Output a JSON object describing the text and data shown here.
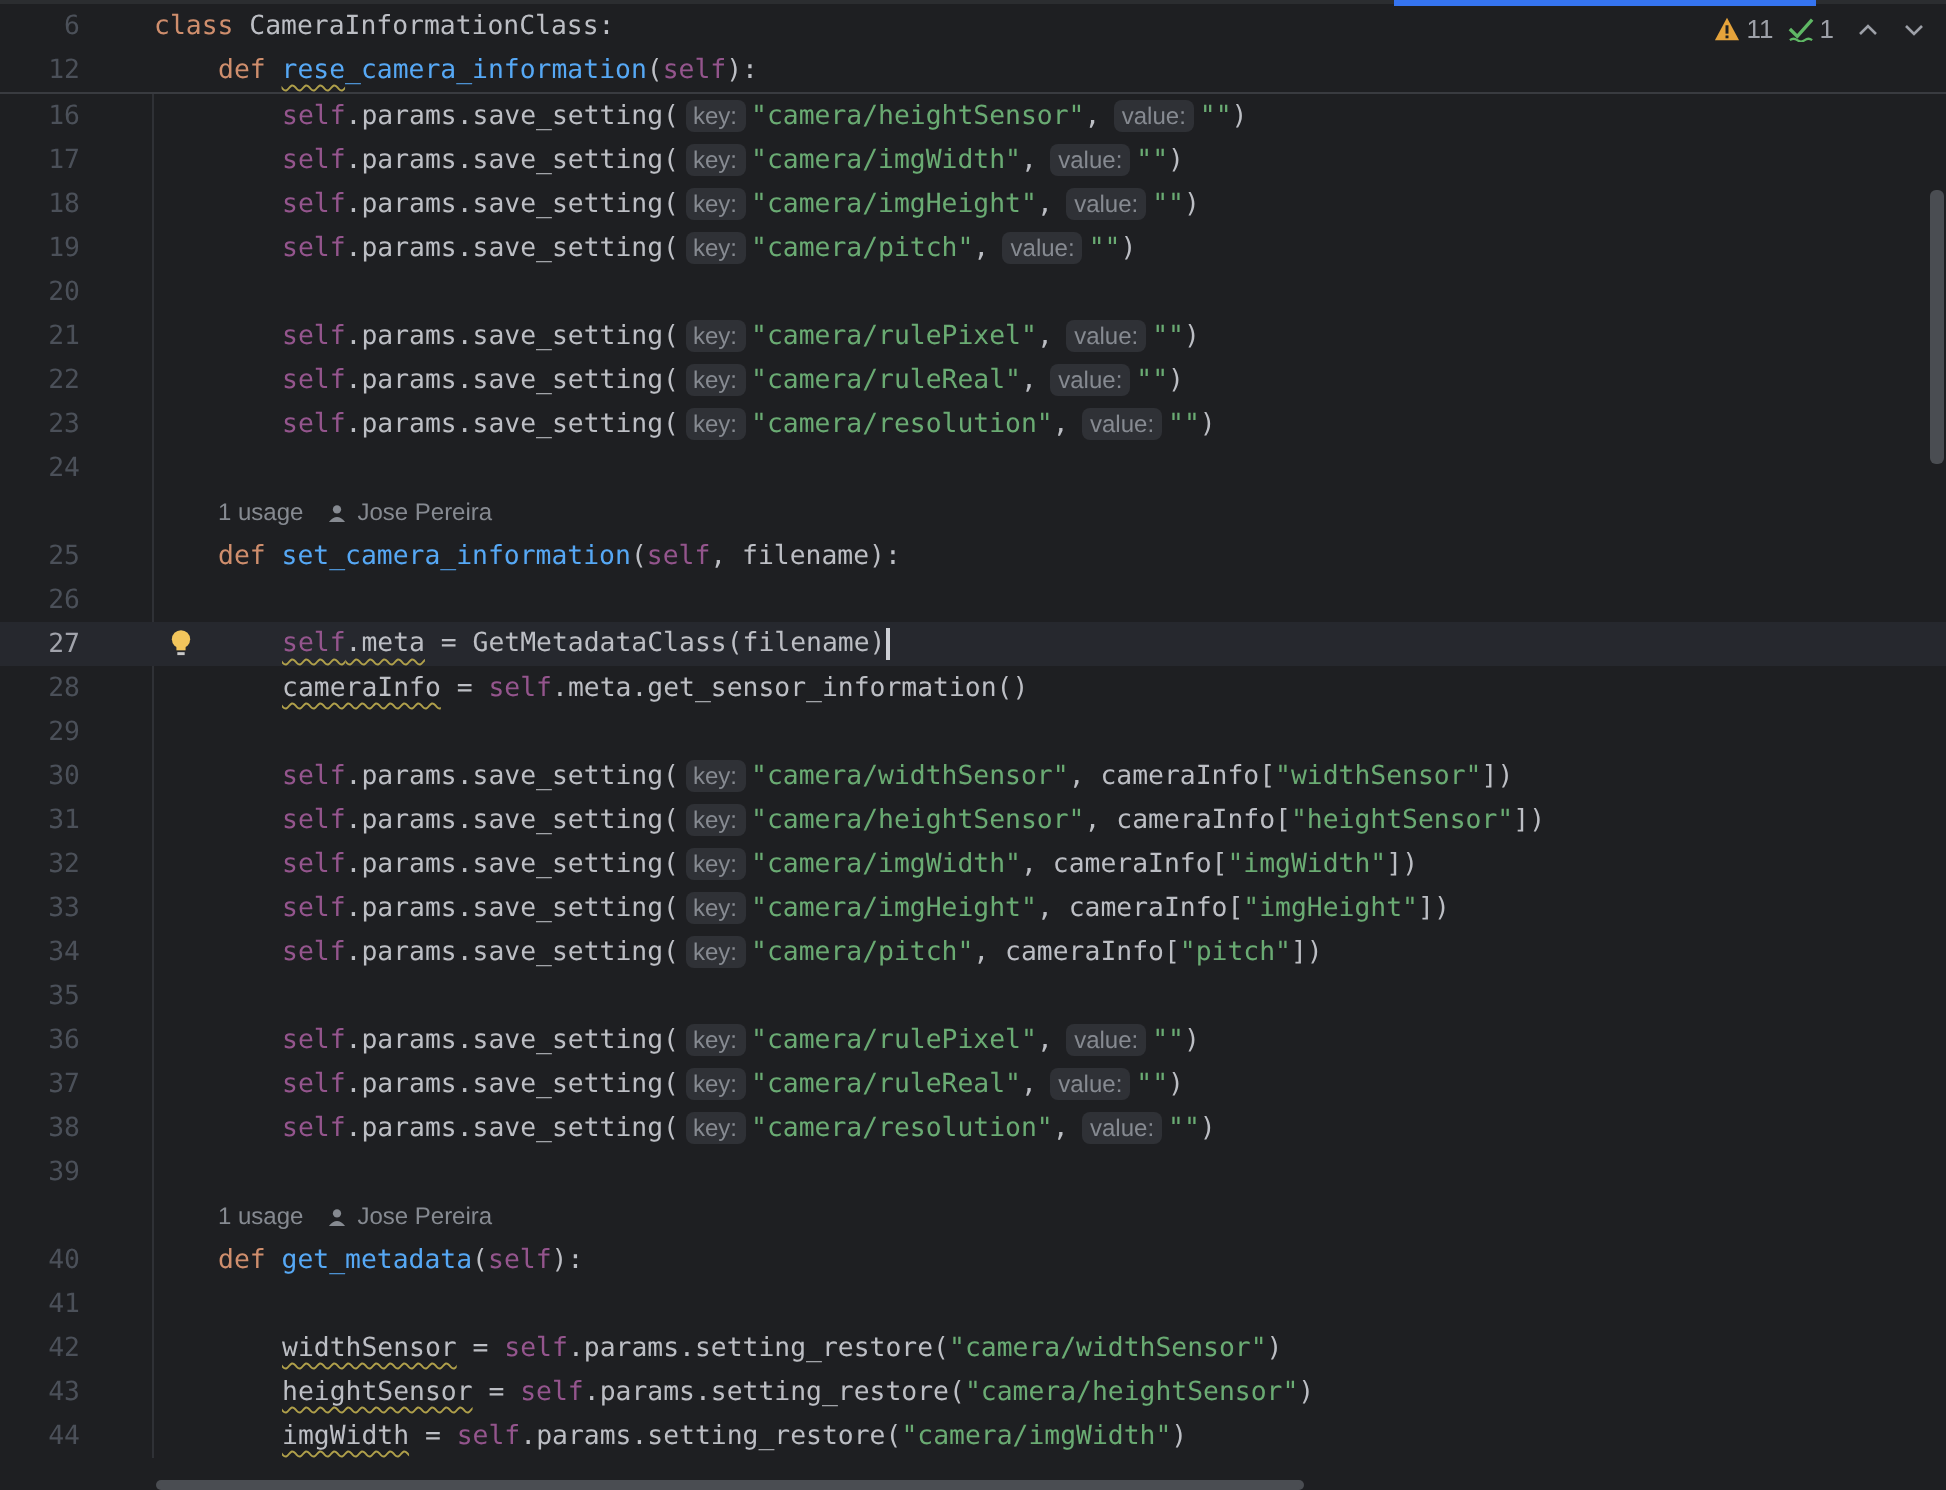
{
  "inspections": {
    "warnings": "11",
    "weak_warnings": "1"
  },
  "sticky_lines": [
    {
      "number": "6",
      "tokens": [
        {
          "text": "class",
          "kind": "kw"
        },
        {
          "text": "CameraInformationClass:",
          "kind": "txt"
        }
      ]
    },
    {
      "number": "12",
      "tokens": [
        {
          "text": "def",
          "kind": "kw"
        },
        {
          "text": "rese",
          "kind": "fn",
          "wavy": true
        },
        {
          "text": "_camera_information",
          "kind": "fn"
        },
        {
          "text": "(",
          "kind": "txt"
        },
        {
          "text": "self",
          "kind": "self"
        },
        {
          "text": "):",
          "kind": "txt"
        }
      ]
    }
  ],
  "functions": [
    {
      "body": [
        {
          "number": "16",
          "current": false,
          "bulb": false,
          "tokens": [
            {
              "text": "self",
              "kind": "self"
            },
            {
              "text": ".params.save_setting(",
              "kind": "txt"
            },
            {
              "text": "key:",
              "kind": "hint"
            },
            {
              "text": "\"camera/heightSensor\"",
              "kind": "str"
            },
            {
              "text": ",",
              "kind": "txt"
            },
            {
              "text": "value:",
              "kind": "hint"
            },
            {
              "text": "\"\"",
              "kind": "str"
            },
            {
              "text": ")",
              "kind": "txt"
            }
          ]
        },
        {
          "number": "17",
          "current": false,
          "bulb": false,
          "tokens": [
            {
              "text": "self",
              "kind": "self"
            },
            {
              "text": ".params.save_setting(",
              "kind": "txt"
            },
            {
              "text": "key:",
              "kind": "hint"
            },
            {
              "text": "\"camera/imgWidth\"",
              "kind": "str"
            },
            {
              "text": ",",
              "kind": "txt"
            },
            {
              "text": "value:",
              "kind": "hint"
            },
            {
              "text": "\"\"",
              "kind": "str"
            },
            {
              "text": ")",
              "kind": "txt"
            }
          ]
        },
        {
          "number": "18",
          "current": false,
          "bulb": false,
          "tokens": [
            {
              "text": "self",
              "kind": "self"
            },
            {
              "text": ".params.save_setting(",
              "kind": "txt"
            },
            {
              "text": "key:",
              "kind": "hint"
            },
            {
              "text": "\"camera/imgHeight\"",
              "kind": "str"
            },
            {
              "text": ",",
              "kind": "txt"
            },
            {
              "text": "value:",
              "kind": "hint"
            },
            {
              "text": "\"\"",
              "kind": "str"
            },
            {
              "text": ")",
              "kind": "txt"
            }
          ]
        },
        {
          "number": "19",
          "current": false,
          "bulb": false,
          "tokens": [
            {
              "text": "self",
              "kind": "self"
            },
            {
              "text": ".params.save_setting(",
              "kind": "txt"
            },
            {
              "text": "key:",
              "kind": "hint"
            },
            {
              "text": "\"camera/pitch\"",
              "kind": "str"
            },
            {
              "text": ",",
              "kind": "txt"
            },
            {
              "text": "value:",
              "kind": "hint"
            },
            {
              "text": "\"\"",
              "kind": "str"
            },
            {
              "text": ")",
              "kind": "txt"
            }
          ]
        },
        {
          "number": "20",
          "current": false,
          "bulb": false
        },
        {
          "number": "21",
          "current": false,
          "bulb": false,
          "tokens": [
            {
              "text": "self",
              "kind": "self"
            },
            {
              "text": ".params.save_setting(",
              "kind": "txt"
            },
            {
              "text": "key:",
              "kind": "hint"
            },
            {
              "text": "\"camera/rulePixel\"",
              "kind": "str"
            },
            {
              "text": ",",
              "kind": "txt"
            },
            {
              "text": "value:",
              "kind": "hint"
            },
            {
              "text": "\"\"",
              "kind": "str"
            },
            {
              "text": ")",
              "kind": "txt"
            }
          ]
        },
        {
          "number": "22",
          "current": false,
          "bulb": false,
          "tokens": [
            {
              "text": "self",
              "kind": "self"
            },
            {
              "text": ".params.save_setting(",
              "kind": "txt"
            },
            {
              "text": "key:",
              "kind": "hint"
            },
            {
              "text": "\"camera/ruleReal\"",
              "kind": "str"
            },
            {
              "text": ",",
              "kind": "txt"
            },
            {
              "text": "value:",
              "kind": "hint"
            },
            {
              "text": "\"\"",
              "kind": "str"
            },
            {
              "text": ")",
              "kind": "txt"
            }
          ]
        },
        {
          "number": "23",
          "current": false,
          "bulb": false,
          "tokens": [
            {
              "text": "self",
              "kind": "self"
            },
            {
              "text": ".params.save_setting(",
              "kind": "txt"
            },
            {
              "text": "key:",
              "kind": "hint"
            },
            {
              "text": "\"camera/resolution\"",
              "kind": "str"
            },
            {
              "text": ",",
              "kind": "txt"
            },
            {
              "text": "value:",
              "kind": "hint"
            },
            {
              "text": "\"\"",
              "kind": "str"
            },
            {
              "text": ")",
              "kind": "txt"
            }
          ]
        },
        {
          "number": "24",
          "current": false,
          "bulb": false
        }
      ]
    },
    {
      "lens": {
        "usages": "1 usage",
        "author": "Jose Pereira"
      },
      "header": {
        "number": "25",
        "current": false,
        "bulb": false,
        "tokens": [
          {
            "text": "def",
            "kind": "kw"
          },
          {
            "text": "set_camera_information",
            "kind": "fn"
          },
          {
            "text": "(",
            "kind": "txt"
          },
          {
            "text": "self",
            "kind": "self"
          },
          {
            "text": ", filename):",
            "kind": "txt"
          }
        ]
      },
      "body": [
        {
          "number": "26",
          "current": false,
          "bulb": false
        },
        {
          "number": "27",
          "current": true,
          "bulb": true,
          "tokens": [
            {
              "text": "self",
              "kind": "self",
              "wavy": true
            },
            {
              "text": ".meta",
              "kind": "txt",
              "wavy": true
            },
            {
              "text": " = GetMetadataClass(filename)",
              "kind": "txt"
            }
          ]
        },
        {
          "number": "28",
          "current": false,
          "bulb": false,
          "tokens": [
            {
              "text": "cameraInfo",
              "kind": "txt",
              "wavy": true
            },
            {
              "text": " = ",
              "kind": "txt"
            },
            {
              "text": "self",
              "kind": "self"
            },
            {
              "text": ".meta.get_sensor_information()",
              "kind": "txt"
            }
          ]
        },
        {
          "number": "29",
          "current": false,
          "bulb": false
        },
        {
          "number": "30",
          "current": false,
          "bulb": false,
          "tokens": [
            {
              "text": "self",
              "kind": "self"
            },
            {
              "text": ".params.save_setting(",
              "kind": "txt"
            },
            {
              "text": "key:",
              "kind": "hint"
            },
            {
              "text": "\"camera/widthSensor\"",
              "kind": "str"
            },
            {
              "text": ", cameraInfo[",
              "kind": "txt"
            },
            {
              "text": "\"widthSensor\"",
              "kind": "str"
            },
            {
              "text": "])",
              "kind": "txt"
            }
          ]
        },
        {
          "number": "31",
          "current": false,
          "bulb": false,
          "tokens": [
            {
              "text": "self",
              "kind": "self"
            },
            {
              "text": ".params.save_setting(",
              "kind": "txt"
            },
            {
              "text": "key:",
              "kind": "hint"
            },
            {
              "text": "\"camera/heightSensor\"",
              "kind": "str"
            },
            {
              "text": ", cameraInfo[",
              "kind": "txt"
            },
            {
              "text": "\"heightSensor\"",
              "kind": "str"
            },
            {
              "text": "])",
              "kind": "txt"
            }
          ]
        },
        {
          "number": "32",
          "current": false,
          "bulb": false,
          "tokens": [
            {
              "text": "self",
              "kind": "self"
            },
            {
              "text": ".params.save_setting(",
              "kind": "txt"
            },
            {
              "text": "key:",
              "kind": "hint"
            },
            {
              "text": "\"camera/imgWidth\"",
              "kind": "str"
            },
            {
              "text": ", cameraInfo[",
              "kind": "txt"
            },
            {
              "text": "\"imgWidth\"",
              "kind": "str"
            },
            {
              "text": "])",
              "kind": "txt"
            }
          ]
        },
        {
          "number": "33",
          "current": false,
          "bulb": false,
          "tokens": [
            {
              "text": "self",
              "kind": "self"
            },
            {
              "text": ".params.save_setting(",
              "kind": "txt"
            },
            {
              "text": "key:",
              "kind": "hint"
            },
            {
              "text": "\"camera/imgHeight\"",
              "kind": "str"
            },
            {
              "text": ", cameraInfo[",
              "kind": "txt"
            },
            {
              "text": "\"imgHeight\"",
              "kind": "str"
            },
            {
              "text": "])",
              "kind": "txt"
            }
          ]
        },
        {
          "number": "34",
          "current": false,
          "bulb": false,
          "tokens": [
            {
              "text": "self",
              "kind": "self"
            },
            {
              "text": ".params.save_setting(",
              "kind": "txt"
            },
            {
              "text": "key:",
              "kind": "hint"
            },
            {
              "text": "\"camera/pitch\"",
              "kind": "str"
            },
            {
              "text": ", cameraInfo[",
              "kind": "txt"
            },
            {
              "text": "\"pitch\"",
              "kind": "str"
            },
            {
              "text": "])",
              "kind": "txt"
            }
          ]
        },
        {
          "number": "35",
          "current": false,
          "bulb": false
        },
        {
          "number": "36",
          "current": false,
          "bulb": false,
          "tokens": [
            {
              "text": "self",
              "kind": "self"
            },
            {
              "text": ".params.save_setting(",
              "kind": "txt"
            },
            {
              "text": "key:",
              "kind": "hint"
            },
            {
              "text": "\"camera/rulePixel\"",
              "kind": "str"
            },
            {
              "text": ",",
              "kind": "txt"
            },
            {
              "text": "value:",
              "kind": "hint"
            },
            {
              "text": "\"\"",
              "kind": "str"
            },
            {
              "text": ")",
              "kind": "txt"
            }
          ]
        },
        {
          "number": "37",
          "current": false,
          "bulb": false,
          "tokens": [
            {
              "text": "self",
              "kind": "self"
            },
            {
              "text": ".params.save_setting(",
              "kind": "txt"
            },
            {
              "text": "key:",
              "kind": "hint"
            },
            {
              "text": "\"camera/ruleReal\"",
              "kind": "str"
            },
            {
              "text": ",",
              "kind": "txt"
            },
            {
              "text": "value:",
              "kind": "hint"
            },
            {
              "text": "\"\"",
              "kind": "str"
            },
            {
              "text": ")",
              "kind": "txt"
            }
          ]
        },
        {
          "number": "38",
          "current": false,
          "bulb": false,
          "tokens": [
            {
              "text": "self",
              "kind": "self"
            },
            {
              "text": ".params.save_setting(",
              "kind": "txt"
            },
            {
              "text": "key:",
              "kind": "hint"
            },
            {
              "text": "\"camera/resolution\"",
              "kind": "str"
            },
            {
              "text": ",",
              "kind": "txt"
            },
            {
              "text": "value:",
              "kind": "hint"
            },
            {
              "text": "\"\"",
              "kind": "str"
            },
            {
              "text": ")",
              "kind": "txt"
            }
          ]
        },
        {
          "number": "39",
          "current": false,
          "bulb": false
        }
      ]
    },
    {
      "lens": {
        "usages": "1 usage",
        "author": "Jose Pereira"
      },
      "header": {
        "number": "40",
        "current": false,
        "bulb": false,
        "tokens": [
          {
            "text": "def",
            "kind": "kw"
          },
          {
            "text": "get_metadata",
            "kind": "fn"
          },
          {
            "text": "(",
            "kind": "txt"
          },
          {
            "text": "self",
            "kind": "self"
          },
          {
            "text": "):",
            "kind": "txt"
          }
        ]
      },
      "body": [
        {
          "number": "41",
          "current": false,
          "bulb": false
        },
        {
          "number": "42",
          "current": false,
          "bulb": false,
          "tokens": [
            {
              "text": "widthSensor",
              "kind": "txt",
              "wavy": true
            },
            {
              "text": " = ",
              "kind": "txt"
            },
            {
              "text": "self",
              "kind": "self"
            },
            {
              "text": ".params.setting_restore(",
              "kind": "txt"
            },
            {
              "text": "\"camera/widthSensor\"",
              "kind": "str"
            },
            {
              "text": ")",
              "kind": "txt"
            }
          ]
        },
        {
          "number": "43",
          "current": false,
          "bulb": false,
          "tokens": [
            {
              "text": "heightSensor",
              "kind": "txt",
              "wavy": true
            },
            {
              "text": " = ",
              "kind": "txt"
            },
            {
              "text": "self",
              "kind": "self"
            },
            {
              "text": ".params.setting_restore(",
              "kind": "txt"
            },
            {
              "text": "\"camera/heightSensor\"",
              "kind": "str"
            },
            {
              "text": ")",
              "kind": "txt"
            }
          ]
        },
        {
          "number": "44",
          "current": false,
          "bulb": false,
          "tokens": [
            {
              "text": "imgWidth",
              "kind": "txt",
              "wavy": true
            },
            {
              "text": " = ",
              "kind": "txt"
            },
            {
              "text": "self",
              "kind": "self"
            },
            {
              "text": ".params.setting_restore(",
              "kind": "txt"
            },
            {
              "text": "\"camera/imgWidth\"",
              "kind": "str"
            },
            {
              "text": ")",
              "kind": "txt"
            }
          ]
        }
      ]
    }
  ]
}
